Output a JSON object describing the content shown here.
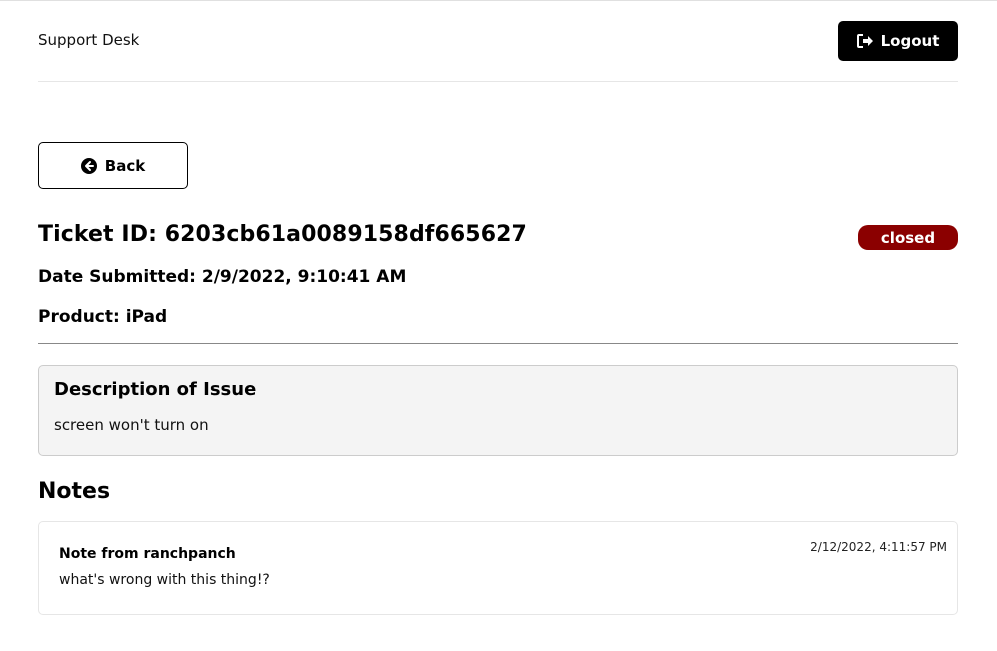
{
  "header": {
    "brand": "Support Desk",
    "logout_label": "Logout",
    "logout_icon": "sign-out-icon"
  },
  "back_button": {
    "label": "Back",
    "icon": "arrow-circle-left-icon"
  },
  "ticket": {
    "title": "Ticket ID: 6203cb61a0089158df665627",
    "status": "closed",
    "status_color": "#8b0000",
    "date_submitted": "Date Submitted: 2/9/2022, 9:10:41 AM",
    "product": "Product: iPad"
  },
  "description": {
    "heading": "Description of Issue",
    "text": "screen won't turn on"
  },
  "notes": {
    "heading": "Notes",
    "items": [
      {
        "author": "Note from ranchpanch",
        "text": "what's wrong with this thing!?",
        "date": "2/12/2022, 4:11:57 PM"
      }
    ]
  }
}
